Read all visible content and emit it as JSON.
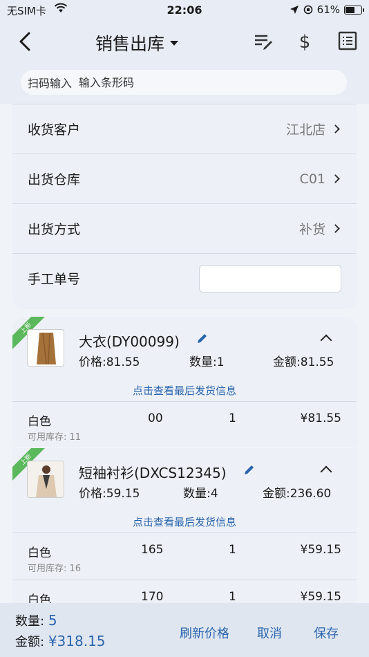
{
  "status": {
    "carrier": "无SIM卡",
    "time": "22:06",
    "battery": "61%",
    "battery_level": 0.61
  },
  "nav": {
    "title": "销售出库",
    "icons": [
      "back-icon",
      "edit-list-icon",
      "dollar-icon",
      "list-icon"
    ]
  },
  "scan": {
    "label": "扫码输入",
    "placeholder": "输入条形码"
  },
  "form": {
    "customer": {
      "label": "收货客户",
      "value": "江北店"
    },
    "warehouse": {
      "label": "出货仓库",
      "value": "C01"
    },
    "method": {
      "label": "出货方式",
      "value": "补货"
    },
    "manual_no": {
      "label": "手工单号",
      "value": ""
    }
  },
  "items": [
    {
      "ribbon": "上新",
      "title": "大衣(DY00099)",
      "price": "价格:81.55",
      "qty": "数量:1",
      "amount": "金额:81.55",
      "last_info": "点击查看最后发货信息",
      "skus": [
        {
          "color": "白色",
          "size": "00",
          "qty": "1",
          "price": "¥81.55",
          "stock": "可用库存: 11"
        }
      ]
    },
    {
      "ribbon": "上新",
      "title": "短袖衬衫(DXCS12345)",
      "price": "价格:59.15",
      "qty": "数量:4",
      "amount": "金额:236.60",
      "last_info": "点击查看最后发货信息",
      "skus": [
        {
          "color": "白色",
          "size": "165",
          "qty": "1",
          "price": "¥59.15",
          "stock": "可用库存: 16"
        },
        {
          "color": "白色",
          "size": "170",
          "qty": "1",
          "price": "¥59.15",
          "stock": ""
        }
      ]
    }
  ],
  "footer": {
    "qty_label": "数量:",
    "qty_value": "5",
    "amount_label": "金额:",
    "amount_value": "¥318.15",
    "refresh": "刷新价格",
    "cancel": "取消",
    "save": "保存"
  }
}
